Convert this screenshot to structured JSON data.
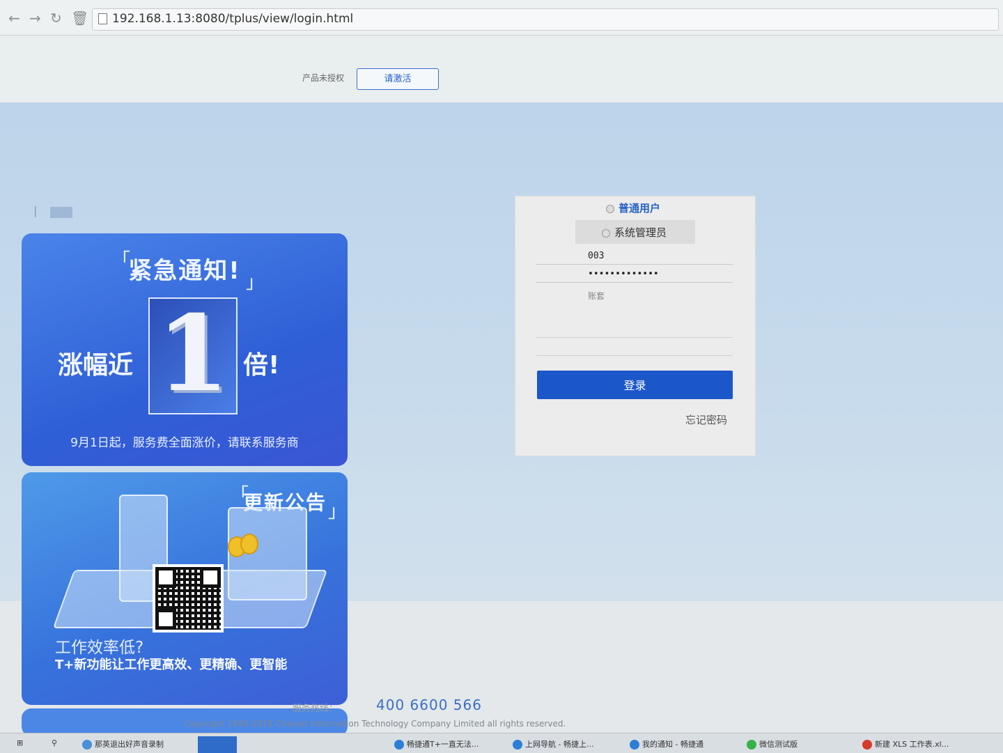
{
  "browser": {
    "url": "192.168.1.13:8080/tplus/view/login.html",
    "back_icon": "arrow-left-icon",
    "forward_icon": "arrow-right-icon",
    "reload_icon": "reload-icon",
    "trash_icon": "trash-icon"
  },
  "header": {
    "unauthorized_text": "产品未授权",
    "activate_label": "请激活"
  },
  "banner1": {
    "title": "紧急通知!",
    "left_text": "涨幅近",
    "digit": "1",
    "right_text": "倍!",
    "footer": "9月1日起，服务费全面涨价，请联系服务商"
  },
  "banner2": {
    "title": "更新公告",
    "subtitle": "工作效率低?",
    "description": "T+新功能让工作更高效、更精确、更智能"
  },
  "login": {
    "role_normal": "普通用户",
    "role_admin": "系统管理员",
    "username_value": "003",
    "password_value": "•••••••••••••",
    "account_label": "账套",
    "login_label": "登录",
    "forgot_label": "忘记密码"
  },
  "footer": {
    "hotline_label": "服务热线：",
    "hotline_number": "400  6600  566",
    "copyright": "Copyright 1988-2018 Chanjet Information Technology Company Limited all rights reserved."
  },
  "taskbar": {
    "items": [
      "那英退出好声音录制",
      "畅捷通T+一直无法...",
      "上网导航 - 畅捷上...",
      "我的通知 - 畅捷通",
      "微信测试版",
      "新建 XLS 工作表.xl..."
    ]
  },
  "colors": {
    "accent": "#1b57c8",
    "banner_blue": "#3a67dc",
    "page_blue": "#c4d8eb"
  }
}
